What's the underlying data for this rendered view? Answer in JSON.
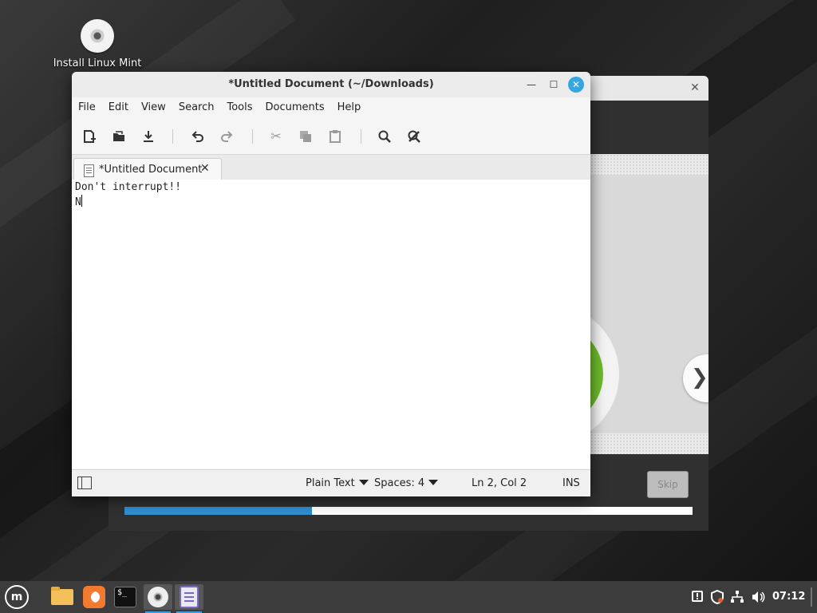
{
  "desktop": {
    "icon_label": "Install Linux Mint"
  },
  "installer": {
    "skip_label": "Skip",
    "next_icon": "chevron-right-icon",
    "close_icon": "close-icon",
    "progress_fraction": 0.33
  },
  "gedit": {
    "title": "*Untitled Document (~/Downloads)",
    "menu": [
      "File",
      "Edit",
      "View",
      "Search",
      "Tools",
      "Documents",
      "Help"
    ],
    "toolbar_icons": [
      "new-document-icon",
      "open-document-icon",
      "save-icon",
      "undo-icon",
      "redo-icon",
      "cut-icon",
      "copy-icon",
      "paste-icon",
      "find-icon",
      "find-replace-icon"
    ],
    "tab_label": "*Untitled Document",
    "content_lines": [
      "Don't interrupt!!",
      "N"
    ],
    "status": {
      "language": "Plain Text",
      "spaces": "Spaces: 4",
      "position": "Ln 2, Col 2",
      "mode": "INS"
    },
    "accent_color": "#35a7e0"
  },
  "panel": {
    "menu_logo": "m",
    "clock": "07:12",
    "launchers": [
      "file-manager-icon",
      "firefox-icon",
      "terminal-icon",
      "install-disc-icon",
      "text-editor-icon"
    ],
    "tray_icons": [
      "notification-icon",
      "update-shield-icon",
      "network-icon",
      "volume-icon"
    ]
  }
}
